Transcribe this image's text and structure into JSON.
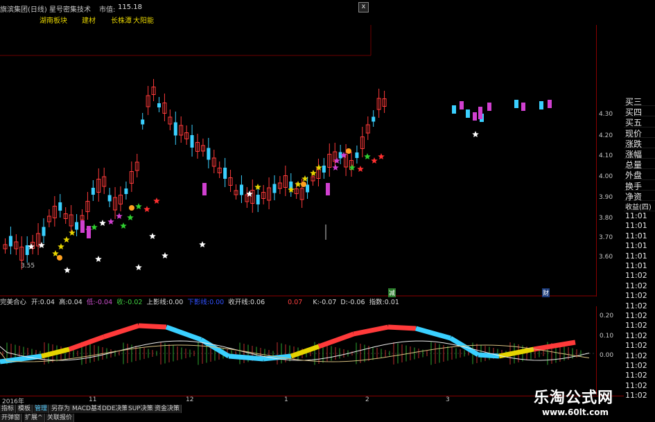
{
  "header": {
    "stock_title": "旗滨集团(日线) 星号密集技术",
    "market_value_label": "市值:",
    "market_value": "115.18",
    "close_symbol": "x",
    "tags": [
      "湖南板块",
      "建材",
      "长株潭",
      "大阳能"
    ]
  },
  "price_axis": {
    "labels": [
      "4.30",
      "4.20",
      "4.10",
      "4.00",
      "3.90",
      "3.80",
      "3.70",
      "3.60"
    ],
    "low_marker": "3.55"
  },
  "quote_panel": {
    "labels": [
      "买三",
      "买四",
      "买五",
      "现价",
      "涨跌",
      "涨幅",
      "总量",
      "外盘",
      "换手",
      "净资",
      "收益(四)"
    ],
    "times": [
      "11:01",
      "11:01",
      "11:01",
      "11:01",
      "11:01",
      "11:01",
      "11:02",
      "11:02",
      "11:02",
      "11:02",
      "11:02",
      "11:02",
      "11:02",
      "11:02",
      "11:02",
      "11:02",
      "11:02",
      "11:02",
      "11:02"
    ]
  },
  "markers": {
    "left": "减",
    "right": "财"
  },
  "indicator": {
    "name": "完美合心",
    "open_label": "开:",
    "open": "0.04",
    "high_label": "高:",
    "high": "0.04",
    "low_label": "低:",
    "low": "-0.04",
    "close_label": "收:",
    "close": "-0.02",
    "upper_label": "上影线:",
    "upper": "0.00",
    "lower_label": "下影线:",
    "lower": "0.00",
    "collect_label": "收开线:",
    "collect": "0.06",
    "extra": "0.07",
    "k_label": "K:",
    "k": "-0.07",
    "d_label": "D:",
    "d": "-0.06",
    "idx_label": "指数:",
    "idx": "0.01",
    "axis": [
      "0.20",
      "0.10",
      "0.00"
    ]
  },
  "date_axis": {
    "year": "2016年",
    "months": [
      "11",
      "12",
      "1",
      "2",
      "3"
    ]
  },
  "tabs": [
    "指标",
    "模板",
    "管理",
    "另存为",
    "MACD基本",
    "DDE决策",
    "SUP决策",
    "资金决策",
    "开弹窗",
    "扩展^",
    "关联报价"
  ],
  "watermark": {
    "title": "乐淘公式网",
    "url": "www.60lt.com"
  },
  "colors": {
    "up": "#ff3a3a",
    "down": "#3ad0ff",
    "axis": "#8b0000",
    "tag": "#e6d400"
  }
}
